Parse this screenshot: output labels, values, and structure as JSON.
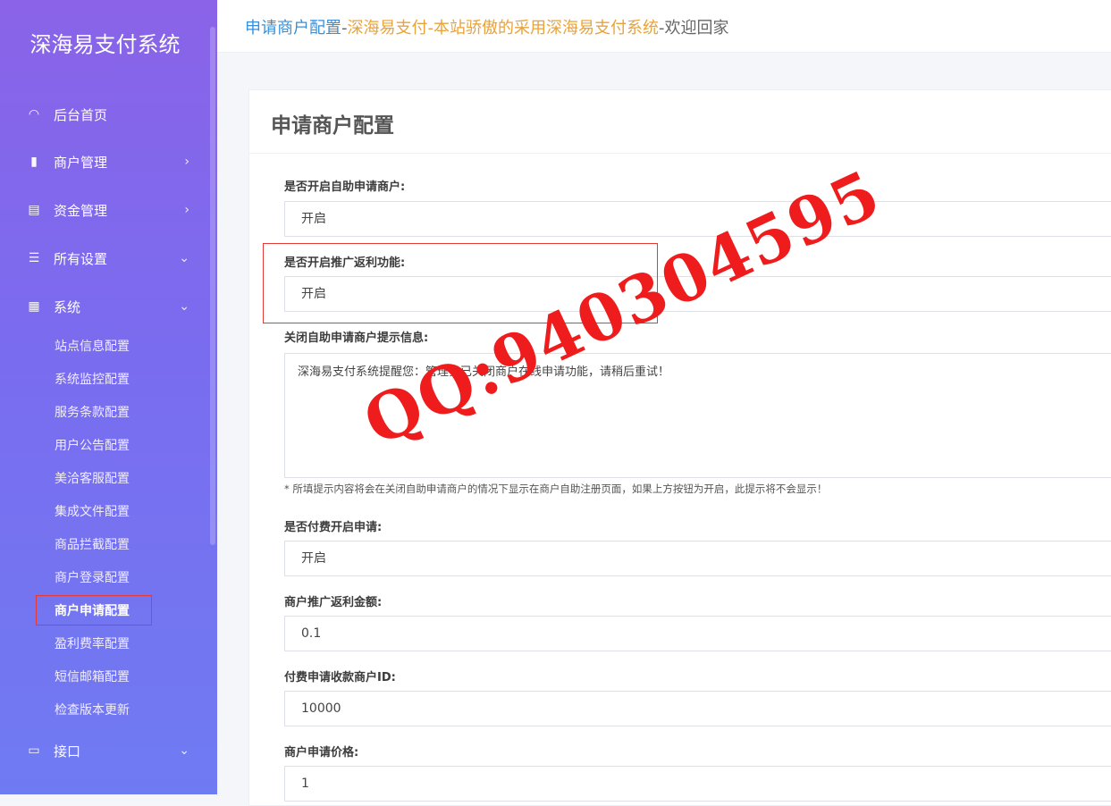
{
  "sidebar": {
    "brand": "深海易支付系统",
    "items": [
      {
        "label": "后台首页",
        "icon": "dashboard-icon",
        "glyph": "◠"
      },
      {
        "label": "商户管理",
        "icon": "bar-chart-icon",
        "glyph": "▮"
      },
      {
        "label": "资金管理",
        "icon": "document-icon",
        "glyph": "▤"
      },
      {
        "label": "所有设置",
        "icon": "list-icon",
        "glyph": "☰"
      },
      {
        "label": "系统",
        "icon": "calculator-icon",
        "glyph": "▦"
      },
      {
        "label": "接口",
        "icon": "folder-icon",
        "glyph": "▭"
      }
    ],
    "sub_items": [
      "站点信息配置",
      "系统监控配置",
      "服务条款配置",
      "用户公告配置",
      "美洽客服配置",
      "集成文件配置",
      "商品拦截配置",
      "商户登录配置",
      "商户申请配置",
      "盈利费率配置",
      "短信邮箱配置",
      "检查版本更新"
    ],
    "active_sub": "商户申请配置"
  },
  "header": {
    "crumb_part1": "申请商户配置",
    "sep": "-",
    "crumb_part2": "深海易支付-本站骄傲的采用深海易支付系统",
    "crumb_part3": "欢迎回家"
  },
  "form": {
    "title": "申请商户配置",
    "fields": [
      {
        "label": "是否开启自助申请商户:",
        "value": "开启"
      },
      {
        "label": "是否开启推广返利功能:",
        "value": "开启"
      },
      {
        "label": "关闭自助申请商户提示信息:",
        "value": "深海易支付系统提醒您：管理员已关闭商户在线申请功能，请稍后重试！"
      },
      {
        "label": "是否付费开启申请:",
        "value": "开启"
      },
      {
        "label": "商户推广返利金额:",
        "value": "0.1"
      },
      {
        "label": "付费申请收款商户ID:",
        "value": "10000"
      },
      {
        "label": "商户申请价格:",
        "value": "1"
      }
    ],
    "hint": "* 所填提示内容将会在关闭自助申请商户的情况下显示在商户自助注册页面，如果上方按钮为开启，此提示将不会显示！"
  },
  "watermark": {
    "text": "QQ:940304595",
    "color": "#ee1c1c"
  }
}
